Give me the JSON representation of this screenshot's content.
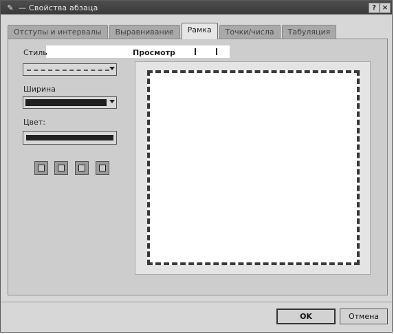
{
  "window": {
    "title": "Свойства абзаца",
    "title_separator": "—",
    "help_label": "?",
    "close_label": "×"
  },
  "tabs": [
    {
      "label": "Отступы и интервалы",
      "active": false
    },
    {
      "label": "Выравнивание",
      "active": false
    },
    {
      "label": "Рамка",
      "active": true
    },
    {
      "label": "Точки/числа",
      "active": false
    },
    {
      "label": "Табуляция",
      "active": false
    }
  ],
  "border": {
    "style_label": "Стиль",
    "style_value": "dashed",
    "width_label": "Ширина",
    "color_label": "Цвет:",
    "color_value": "#222222",
    "preview_label": "Просмотр"
  },
  "buttons": {
    "ok": "OK",
    "cancel": "Отмена"
  }
}
